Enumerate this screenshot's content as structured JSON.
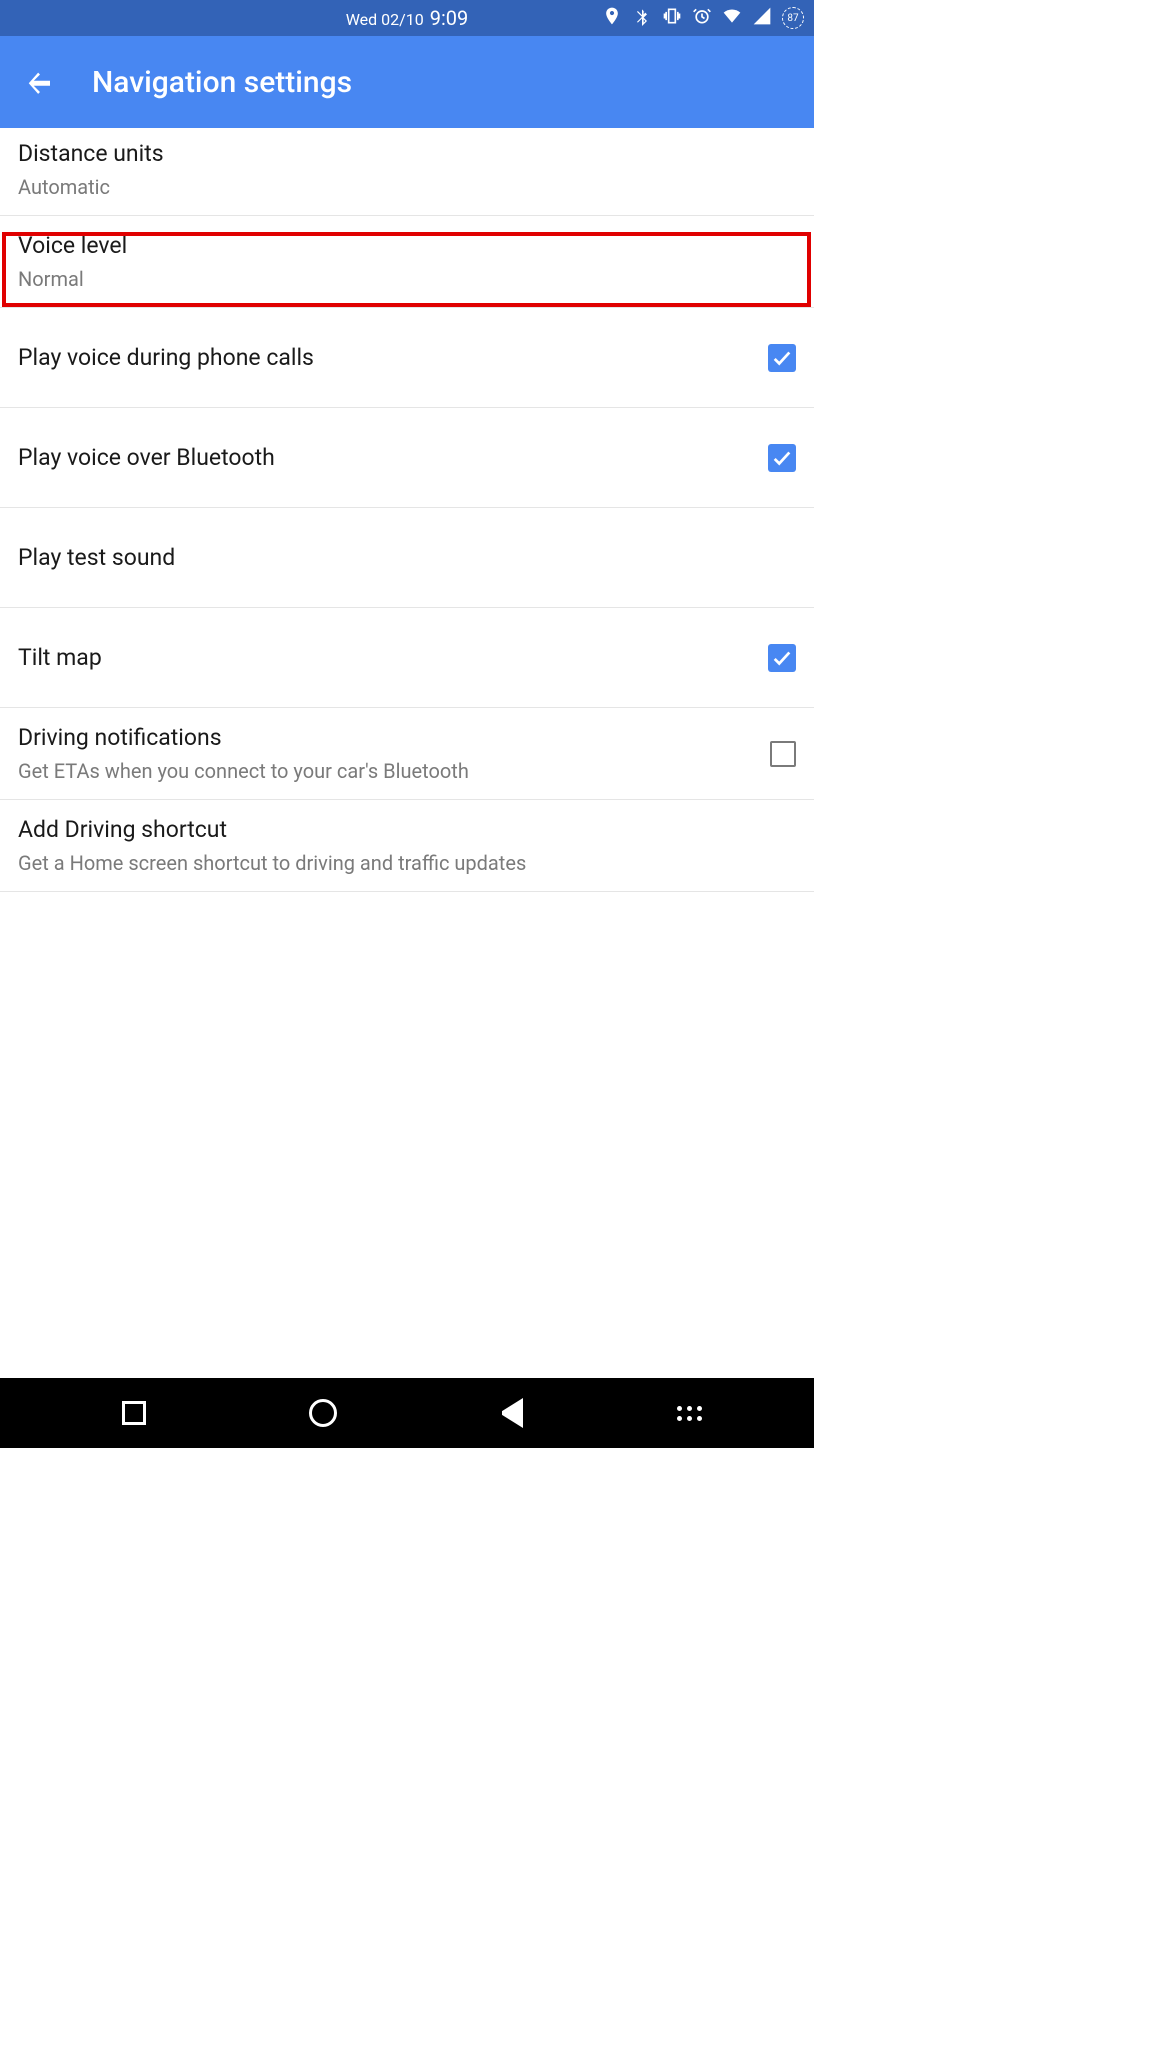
{
  "status": {
    "date": "Wed 02/10",
    "time": "9:09",
    "battery": "87"
  },
  "header": {
    "title": "Navigation settings"
  },
  "settings": {
    "distance_units": {
      "title": "Distance units",
      "value": "Automatic"
    },
    "voice_level": {
      "title": "Voice level",
      "value": "Normal"
    },
    "play_voice_calls": {
      "title": "Play voice during phone calls",
      "checked": true
    },
    "play_voice_bt": {
      "title": "Play voice over Bluetooth",
      "checked": true
    },
    "play_test": {
      "title": "Play test sound"
    },
    "tilt_map": {
      "title": "Tilt map",
      "checked": true
    },
    "driving_notif": {
      "title": "Driving notifications",
      "subtitle": "Get ETAs when you connect to your car's Bluetooth",
      "checked": false
    },
    "add_shortcut": {
      "title": "Add Driving shortcut",
      "subtitle": "Get a Home screen shortcut to driving and traffic updates"
    }
  }
}
